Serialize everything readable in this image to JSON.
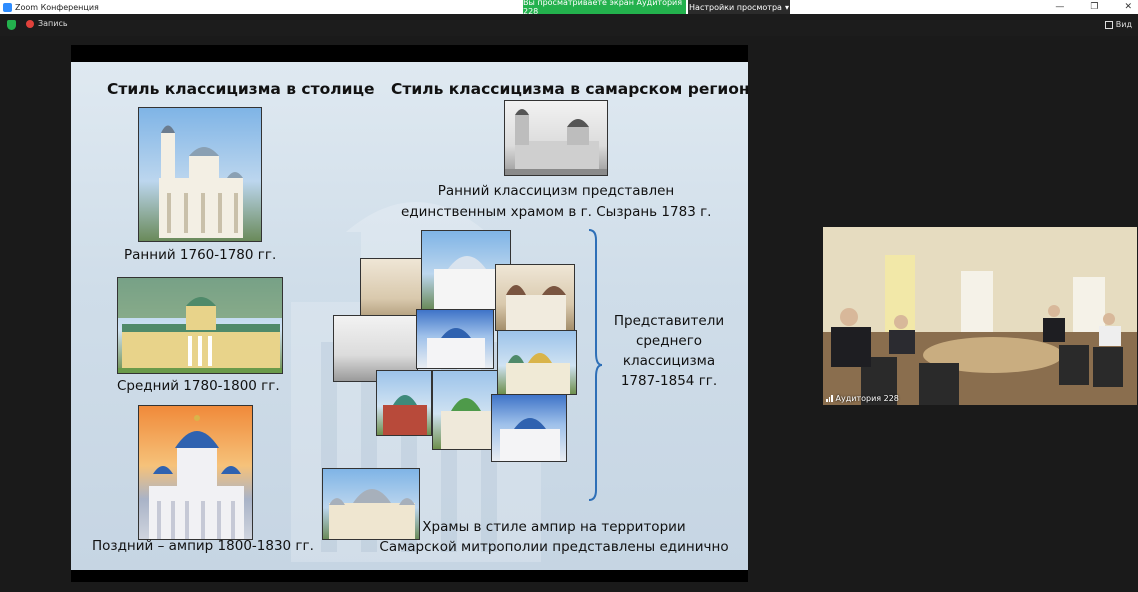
{
  "window": {
    "title": "Zoom Конференция",
    "share_notice": "Вы просматриваете экран Аудитория 228",
    "view_options": "Настройки просмотра",
    "minimize": "—",
    "restore": "❐",
    "close": "✕"
  },
  "toolbar": {
    "record_label": "Запись",
    "view_label": "Вид"
  },
  "slide": {
    "title_left": "Стиль классицизма в столице",
    "title_right": "Стиль классицизма в самарском регионе",
    "caption_early": "Ранний 1760-1780 гг.",
    "caption_middle": "Средний 1780-1800 гг.",
    "caption_late": "Поздний – ампир 1800-1830 гг.",
    "early_classic_line1": "Ранний классицизм представлен",
    "early_classic_line2": "единственным храмом в г. Сызрань 1783 г.",
    "representatives_line1": "Представители",
    "representatives_line2": "среднего",
    "representatives_line3": "классицизма",
    "representatives_line4": "1787-1854 гг.",
    "empire_line1": "Храмы в стиле ампир на территории",
    "empire_line2": "Самарской митрополии представлены единично"
  },
  "participant": {
    "name": "Аудитория 228"
  },
  "colors": {
    "share_green": "#23b14d",
    "brace_blue": "#2e6fb7",
    "record_red": "#e0413b"
  }
}
